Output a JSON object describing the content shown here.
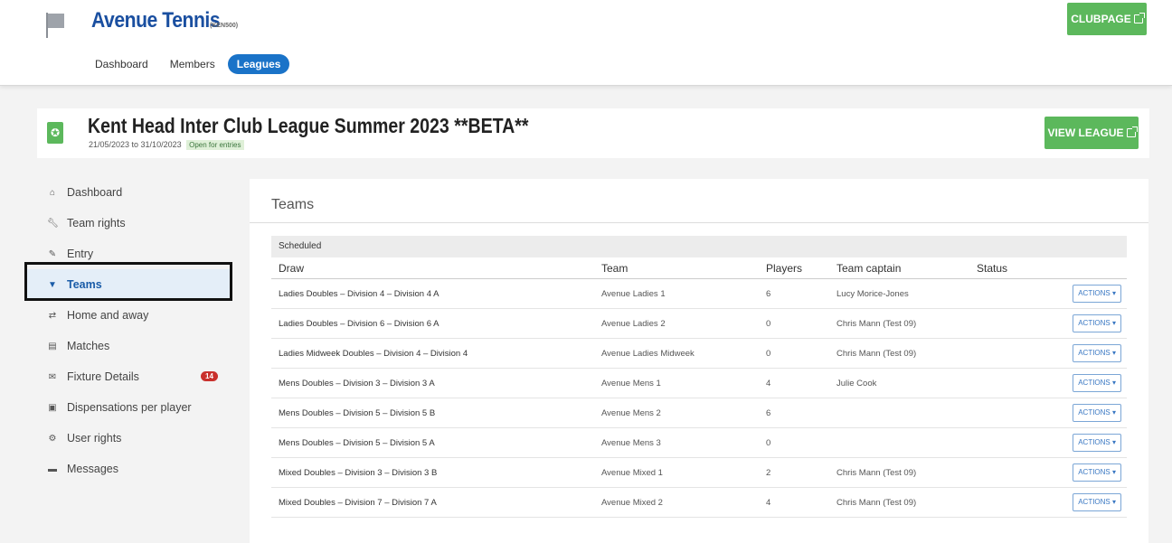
{
  "header": {
    "club_name": "Avenue Tennis",
    "club_code": "(KEN500)",
    "clubpage_label": "CLUBPAGE",
    "nav": [
      {
        "label": "Dashboard",
        "active": false
      },
      {
        "label": "Members",
        "active": false
      },
      {
        "label": "Leagues",
        "active": true
      }
    ]
  },
  "league": {
    "title": "Kent Head Inter Club League Summer 2023 **BETA**",
    "dates": "21/05/2023 to 31/10/2023",
    "status": "Open for entries",
    "view_label": "VIEW LEAGUE"
  },
  "sidebar": {
    "items": [
      {
        "label": "Dashboard",
        "icon": "home-icon"
      },
      {
        "label": "Team rights",
        "icon": "wrench-icon"
      },
      {
        "label": "Entry",
        "icon": "pencil-icon"
      },
      {
        "label": "Teams",
        "icon": "shirt-icon",
        "active": true
      },
      {
        "label": "Home and away",
        "icon": "swap-icon"
      },
      {
        "label": "Matches",
        "icon": "calendar-icon"
      },
      {
        "label": "Fixture Details",
        "icon": "envelope-icon",
        "badge": "14"
      },
      {
        "label": "Dispensations per player",
        "icon": "id-card-icon"
      },
      {
        "label": "User rights",
        "icon": "gear-icon"
      },
      {
        "label": "Messages",
        "icon": "comment-icon"
      }
    ]
  },
  "main": {
    "title": "Teams",
    "group": "Scheduled",
    "columns": {
      "draw": "Draw",
      "team": "Team",
      "players": "Players",
      "captain": "Team captain",
      "status": "Status"
    },
    "actions_label": "ACTIONS ▾",
    "rows": [
      {
        "draw": "Ladies Doubles – Division 4 – Division 4 A",
        "team": "Avenue Ladies 1",
        "players": "6",
        "captain": "Lucy Morice-Jones",
        "status": ""
      },
      {
        "draw": "Ladies Doubles – Division 6 – Division 6 A",
        "team": "Avenue Ladies 2",
        "players": "0",
        "captain": "Chris Mann (Test 09)",
        "status": ""
      },
      {
        "draw": "Ladies Midweek Doubles – Division 4 – Division 4",
        "team": "Avenue Ladies Midweek",
        "players": "0",
        "captain": "Chris Mann (Test 09)",
        "status": ""
      },
      {
        "draw": "Mens Doubles – Division 3 – Division 3 A",
        "team": "Avenue Mens 1",
        "players": "4",
        "captain": "Julie Cook",
        "status": ""
      },
      {
        "draw": "Mens Doubles – Division 5 – Division 5 B",
        "team": "Avenue Mens 2",
        "players": "6",
        "captain": "",
        "status": ""
      },
      {
        "draw": "Mens Doubles – Division 5 – Division 5 A",
        "team": "Avenue Mens 3",
        "players": "0",
        "captain": "",
        "status": ""
      },
      {
        "draw": "Mixed Doubles – Division 3 – Division 3 B",
        "team": "Avenue Mixed 1",
        "players": "2",
        "captain": "Chris Mann (Test 09)",
        "status": ""
      },
      {
        "draw": "Mixed Doubles – Division 7 – Division 7 A",
        "team": "Avenue Mixed 2",
        "players": "4",
        "captain": "Chris Mann (Test 09)",
        "status": ""
      }
    ]
  },
  "colors": {
    "brand_blue": "#1a4fa0",
    "accent_green": "#5cb85c",
    "badge_red": "#c9302c"
  }
}
